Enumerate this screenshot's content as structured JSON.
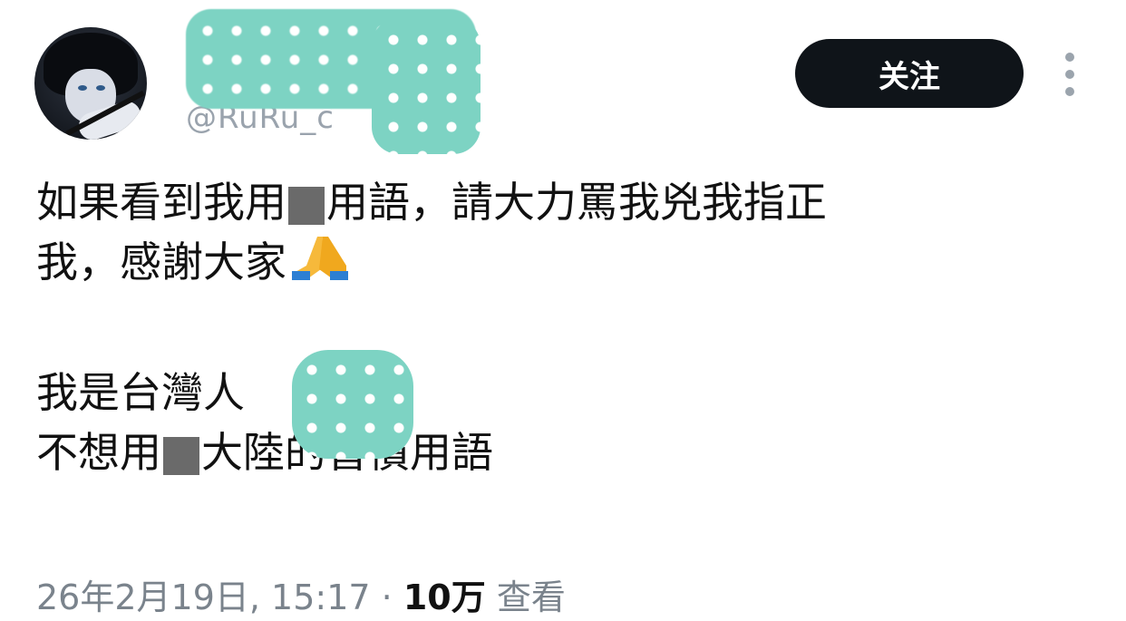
{
  "tweet": {
    "handle": "@RuRu_c",
    "follow_label": "关注",
    "text_line1_a": "如果看到我用",
    "text_line1_b": "用語，請大力罵我兇我指正",
    "text_line2": "我，感謝大家",
    "text_line3": "我是台灣人",
    "text_line4_a": "不想用",
    "text_line4_b": "大陸的習慣用語",
    "emoji": "folded-hands-icon",
    "timestamp": "26年2月19日, 15:17",
    "separator": "·",
    "views": "10万",
    "views_label": "查看"
  },
  "colors": {
    "follow_bg": "#0f1419",
    "blur_teal": "#7dd3c3",
    "meta_gray": "#7a838c"
  }
}
